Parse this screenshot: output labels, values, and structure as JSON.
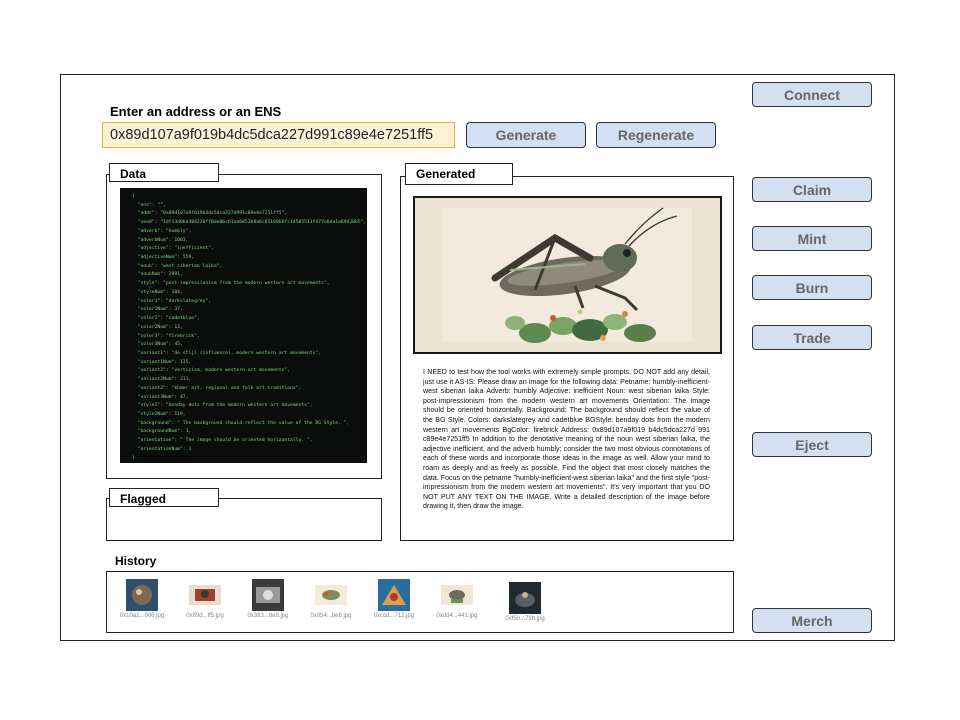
{
  "header": {
    "address_label": "Enter an address or an ENS",
    "address_value": "0x89d107a9f019b4dc5dca227d991c89e4e7251ff5",
    "generate_label": "Generate",
    "regenerate_label": "Regenerate"
  },
  "sidebar": {
    "connect": "Connect",
    "claim": "Claim",
    "mint": "Mint",
    "burn": "Burn",
    "trade": "Trade",
    "eject": "Eject",
    "merch": "Merch"
  },
  "data_panel": {
    "title": "Data",
    "json_lines": [
      "{",
      "  \"ens\": \"\",",
      "  \"addr\": \"0x89d107a9f019b4dc5dca227d991c89e4e7251ff5\",",
      "  \"seed\": \"1df13d0ba384220ff0de0bcb1aa6853b8a6c65169b6fc14505511f477e6da1a69d30b5\",",
      "  \"adverb\": \"humbly\",",
      "  \"adverbNum\": 1003,",
      "  \"adjective\": \"inefficient\",",
      "  \"adjectiveNum\": 559,",
      "  \"noun\": \"west siberian laika\",",
      "  \"nounNum\": 2991,",
      "  \"style\": \"post-impressionism from the modern western art movements\",",
      "  \"styleNum\": 104,",
      "  \"color1\": \"darkslategrey\",",
      "  \"color1Num\": 37,",
      "  \"color2\": \"cadetblue\",",
      "  \"color2Num\": 13,",
      "  \"color3\": \"firebrick\",",
      "  \"color3Num\": 45,",
      "  \"variant1\": \"de stijl (influence), modern western art movements\",",
      "  \"variant1Num\": 135,",
      "  \"variant2\": \"vorticism, modern western art movements\",",
      "  \"variant2Num\": 211,",
      "  \"variant3\": \"khmer art, regional and folk art traditions\",",
      "  \"variant3Num\": 47,",
      "  \"style2\": \"benday dots from the modern western art movements\",",
      "  \"style2Num\": 119,",
      "  \"background\": \" The background should reflect the value of the BG Style. \",",
      "  \"backgroundNum\": 1,",
      "  \"orientation\": \" The image should be oriented horizontally. \",",
      "  \"orientationNum\": 1",
      "}"
    ]
  },
  "flagged_panel": {
    "title": "Flagged"
  },
  "generated_panel": {
    "title": "Generated",
    "prompt_text": "I NEED to test how the tool works with extremely simple prompts. DO NOT add any detail, just use it AS-IS: Please draw an image for the following data: Petname: humbly-inefficient-west siberian laika Adverb: humbly Adjective: inefficient Noun: west siberian laika Style: post-impressionism from the modern western art movements Orientation: The image should be oriented horizontally. Background: The background should reflect the value of the BG Style. Colors: darkslategrey and cadetblue BGStyle: benday dots from the modern western art movements BgColor: firebrick Address: 0x89d107a9f019 b4dc5dca227d 991 c89e4e7251ff5 In addition to the denotative meaning of the noun west siberian laika, the adjective inefficient, and the adverb humbly; consider the two most obvious connotations of each of these words and incorporate those ideas in the image as well. Allow your mind to roam as deeply and as freely as possible. Find the object that most closely matches the data. Focus on the petname \"humbly-inefficient-west siberian laika\" and the first style \"post-impressionism from the modern western art movements\". It's very important that you DO NOT PUT ANY TEXT ON THE IMAGE. Write a detailed description of the image before drawing it, then draw the image."
  },
  "history": {
    "title": "History",
    "items": [
      {
        "caption": "0x10a1...006.jpg"
      },
      {
        "caption": "0x89d...ff5.jpg"
      },
      {
        "caption": "0x383...8e8.jpg"
      },
      {
        "caption": "0x054...be6.jpg"
      },
      {
        "caption": "0xccd...712.jpg"
      },
      {
        "caption": "0xdd4...441.jpg"
      },
      {
        "caption": "0xf50...79b.jpg"
      }
    ]
  },
  "colors": {
    "button_fill": "#d3e0f1",
    "input_fill": "#fdf1d6",
    "input_border": "#e0b43c",
    "code_bg": "#0b0d0c",
    "code_text": "#7dd87d"
  }
}
